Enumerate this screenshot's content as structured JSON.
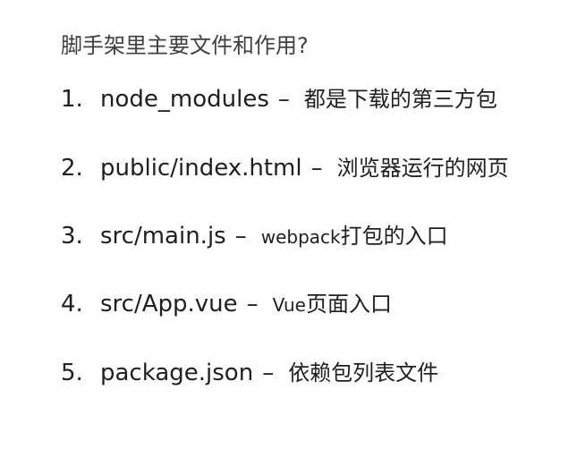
{
  "slide": {
    "title": "脚手架里主要文件和作用?",
    "items": [
      {
        "number": "1.",
        "file": "node_modules",
        "dash": "–",
        "prefix": "",
        "desc": "都是下载的第三方包"
      },
      {
        "number": "2.",
        "file": "public/index.html",
        "dash": "–",
        "prefix": "",
        "desc": "浏览器运行的网页"
      },
      {
        "number": "3.",
        "file": "src/main.js",
        "dash": "–",
        "prefix": "webpack",
        "desc": "打包的入口"
      },
      {
        "number": "4.",
        "file": "src/App.vue",
        "dash": "–",
        "prefix": "Vue",
        "desc": "页面入口"
      },
      {
        "number": "5.",
        "file": "package.json",
        "dash": "–",
        "prefix": "",
        "desc": "依赖包列表文件"
      }
    ]
  }
}
